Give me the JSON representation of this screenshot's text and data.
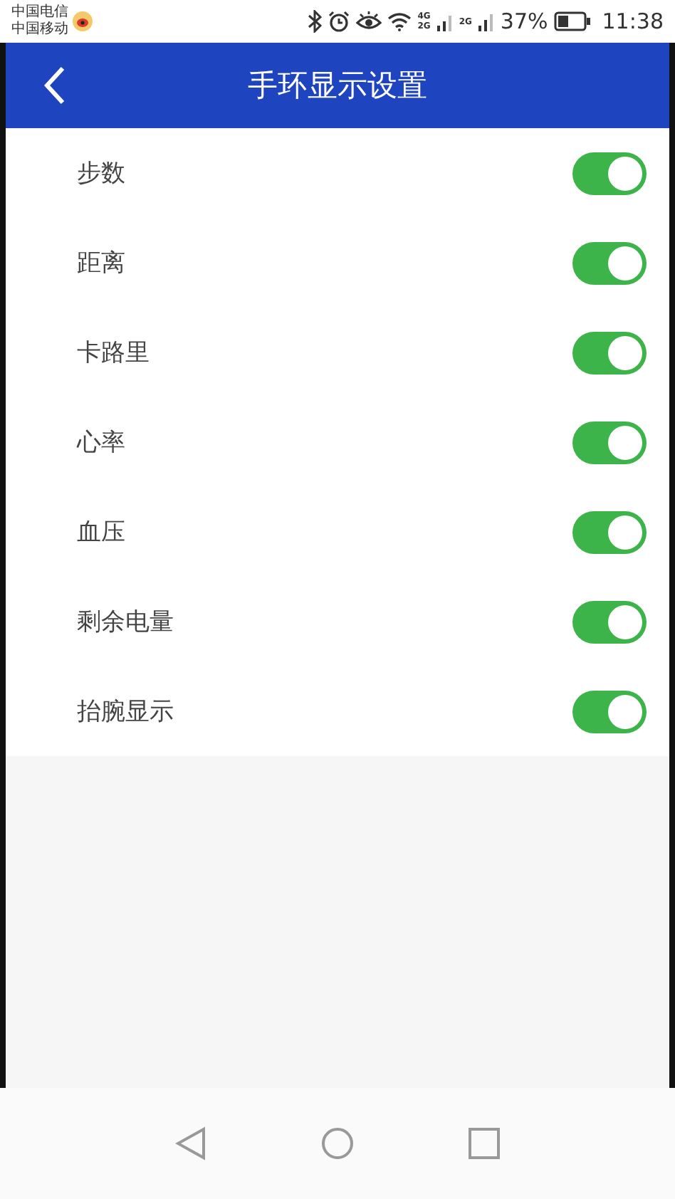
{
  "status_bar": {
    "carriers": [
      "中国电信",
      "中国移动"
    ],
    "network_1": [
      "4G",
      "2G"
    ],
    "network_2": "2G",
    "battery_text": "37%",
    "time": "11:38"
  },
  "header": {
    "title": "手环显示设置"
  },
  "settings": [
    {
      "label": "步数",
      "on": true
    },
    {
      "label": "距离",
      "on": true
    },
    {
      "label": "卡路里",
      "on": true
    },
    {
      "label": "心率",
      "on": true
    },
    {
      "label": "血压",
      "on": true
    },
    {
      "label": "剩余电量",
      "on": true
    },
    {
      "label": "抬腕显示",
      "on": true
    }
  ]
}
